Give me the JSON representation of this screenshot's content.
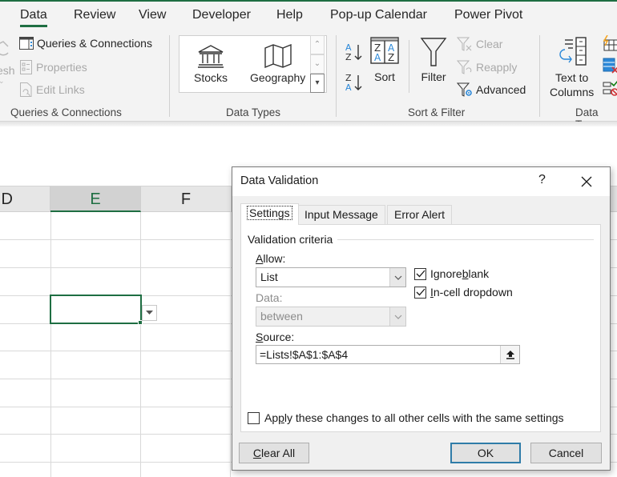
{
  "ribbon": {
    "tabs": [
      {
        "label": "Data",
        "active": true
      },
      {
        "label": "Review"
      },
      {
        "label": "View"
      },
      {
        "label": "Developer"
      },
      {
        "label": "Help"
      },
      {
        "label": "Pop-up Calendar"
      },
      {
        "label": "Power Pivot"
      }
    ],
    "groups": {
      "queries": {
        "refresh_partial": "esh",
        "queries_connections": "Queries & Connections",
        "properties": "Properties",
        "edit_links": "Edit Links",
        "label": "Queries & Connections"
      },
      "data_types": {
        "stocks": "Stocks",
        "geography": "Geography",
        "label": "Data Types"
      },
      "sort_filter": {
        "sort": "Sort",
        "filter": "Filter",
        "clear": "Clear",
        "reapply": "Reapply",
        "advanced": "Advanced",
        "label": "Sort & Filter"
      },
      "data_tools": {
        "text_to_columns_line1": "Text to",
        "text_to_columns_line2": "Columns",
        "label": "Data Too"
      }
    }
  },
  "sheet": {
    "columns": [
      {
        "label": "D"
      },
      {
        "label": "E",
        "selected": true
      },
      {
        "label": "F"
      }
    ],
    "active_cell": "E4",
    "accent_color": "#1e6e42"
  },
  "dialog": {
    "title": "Data Validation",
    "help": "?",
    "tabs": [
      {
        "label": "Settings",
        "active": true
      },
      {
        "label": "Input Message"
      },
      {
        "label": "Error Alert"
      }
    ],
    "section_title": "Validation criteria",
    "allow": {
      "label_u": "A",
      "label_rest": "llow:",
      "value": "List"
    },
    "data": {
      "label": "Data:",
      "value": "between",
      "disabled": true
    },
    "ignore_blank": {
      "label_pre": "Ignore ",
      "label_u": "b",
      "label_post": "lank",
      "checked": true
    },
    "in_cell_dropdown": {
      "label_u": "I",
      "label_rest": "n-cell dropdown",
      "checked": true
    },
    "source": {
      "label_u": "S",
      "label_rest": "ource:",
      "value": "=Lists!$A$1:$A$4"
    },
    "apply_all": {
      "label_pre": "Ap",
      "label_u": "p",
      "label_post": "ly these changes to all other cells with the same settings",
      "checked": false
    },
    "buttons": {
      "clear_all_u": "C",
      "clear_all_rest": "lear All",
      "ok": "OK",
      "cancel": "Cancel"
    },
    "default_button_color": "#2f7ca8"
  }
}
